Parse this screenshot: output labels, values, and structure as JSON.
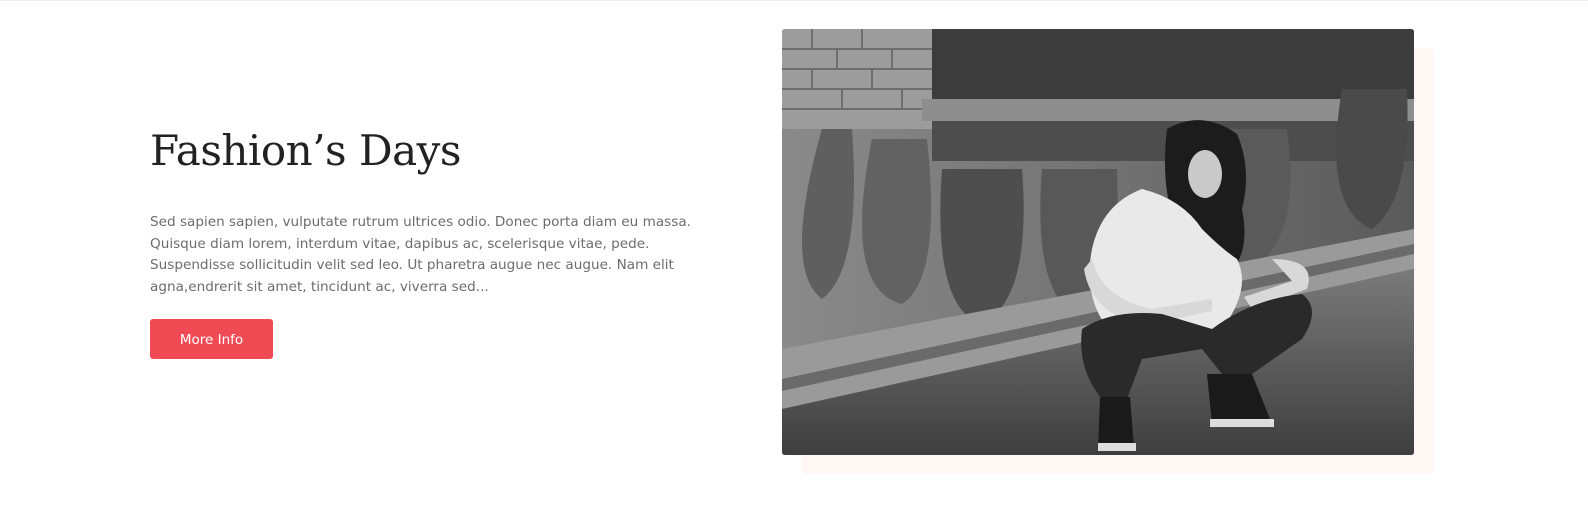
{
  "feature": {
    "title": "Fashion’s Days",
    "description": "Sed sapien sapien, vulputate rutrum ultrices odio. Donec porta diam eu massa. Quisque diam lorem, interdum vitae, dapibus ac, scelerisque vitae, pede. Suspendisse sollicitudin velit sed leo. Ut pharetra augue nec augue. Nam elit agna,endrerit sit amet, tincidunt ac, viverra sed...",
    "button_label": "More Info",
    "image_icon": "photo-woman-crouching-graffiti-wall"
  },
  "colors": {
    "accent": "#f04b55",
    "heading": "#222222",
    "body_text": "#6c6c6c",
    "image_backdrop": "#fff7f4"
  }
}
